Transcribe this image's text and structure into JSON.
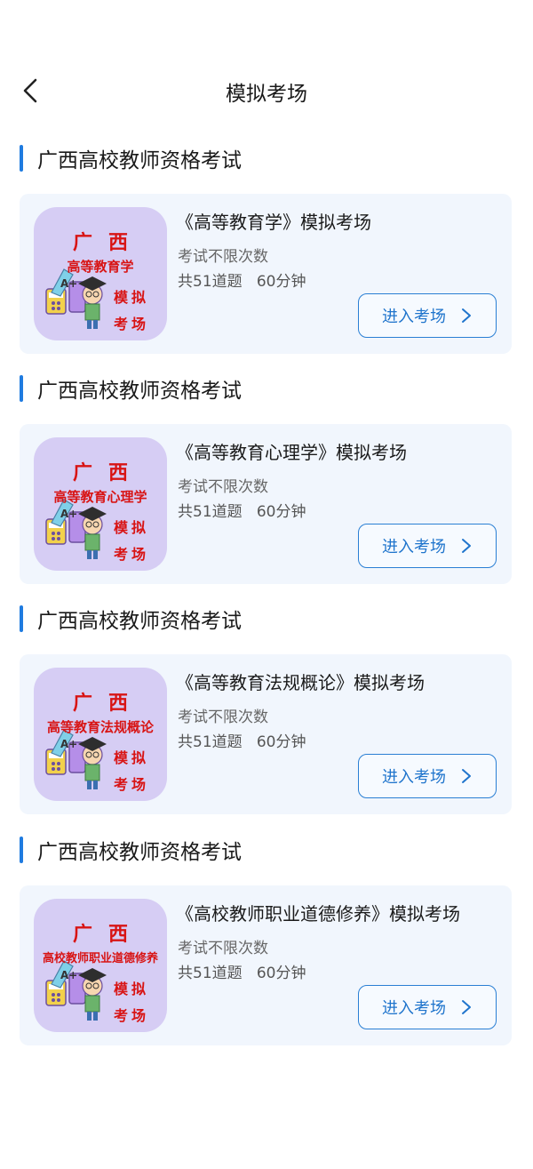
{
  "header": {
    "title": "模拟考场",
    "back_icon": "chevron-left-icon"
  },
  "sections": [
    {
      "heading": "广西高校教师资格考试",
      "card": {
        "title": "《高等教育学》模拟考场",
        "limit": "考试不限次数",
        "meta": "共51道题   60分钟",
        "button": "进入考场",
        "cover": {
          "line1": "广西",
          "line2": "高等教育学",
          "line3": "模拟",
          "line4": "考场"
        }
      }
    },
    {
      "heading": "广西高校教师资格考试",
      "card": {
        "title": "《高等教育心理学》模拟考场",
        "limit": "考试不限次数",
        "meta": "共51道题   60分钟",
        "button": "进入考场",
        "cover": {
          "line1": "广西",
          "line2": "高等教育心理学",
          "line3": "模拟",
          "line4": "考场"
        }
      }
    },
    {
      "heading": "广西高校教师资格考试",
      "card": {
        "title": "《高等教育法规概论》模拟考场",
        "limit": "考试不限次数",
        "meta": "共51道题   60分钟",
        "button": "进入考场",
        "cover": {
          "line1": "广西",
          "line2": "高等教育法规概论",
          "line3": "模拟",
          "line4": "考场"
        }
      }
    },
    {
      "heading": "广西高校教师资格考试",
      "card": {
        "title": "《高校教师职业道德修养》模拟考场",
        "limit": "考试不限次数",
        "meta": "共51道题   60分钟",
        "button": "进入考场",
        "cover": {
          "line1": "广西",
          "line2": "高校教师职业道德修养",
          "line3": "模拟",
          "line4": "考场"
        }
      }
    }
  ],
  "colors": {
    "accent": "#1f7be0",
    "card_bg": "#f1f6fd",
    "cover_bg": "#d6cdf4",
    "cover_text": "#d81414"
  }
}
